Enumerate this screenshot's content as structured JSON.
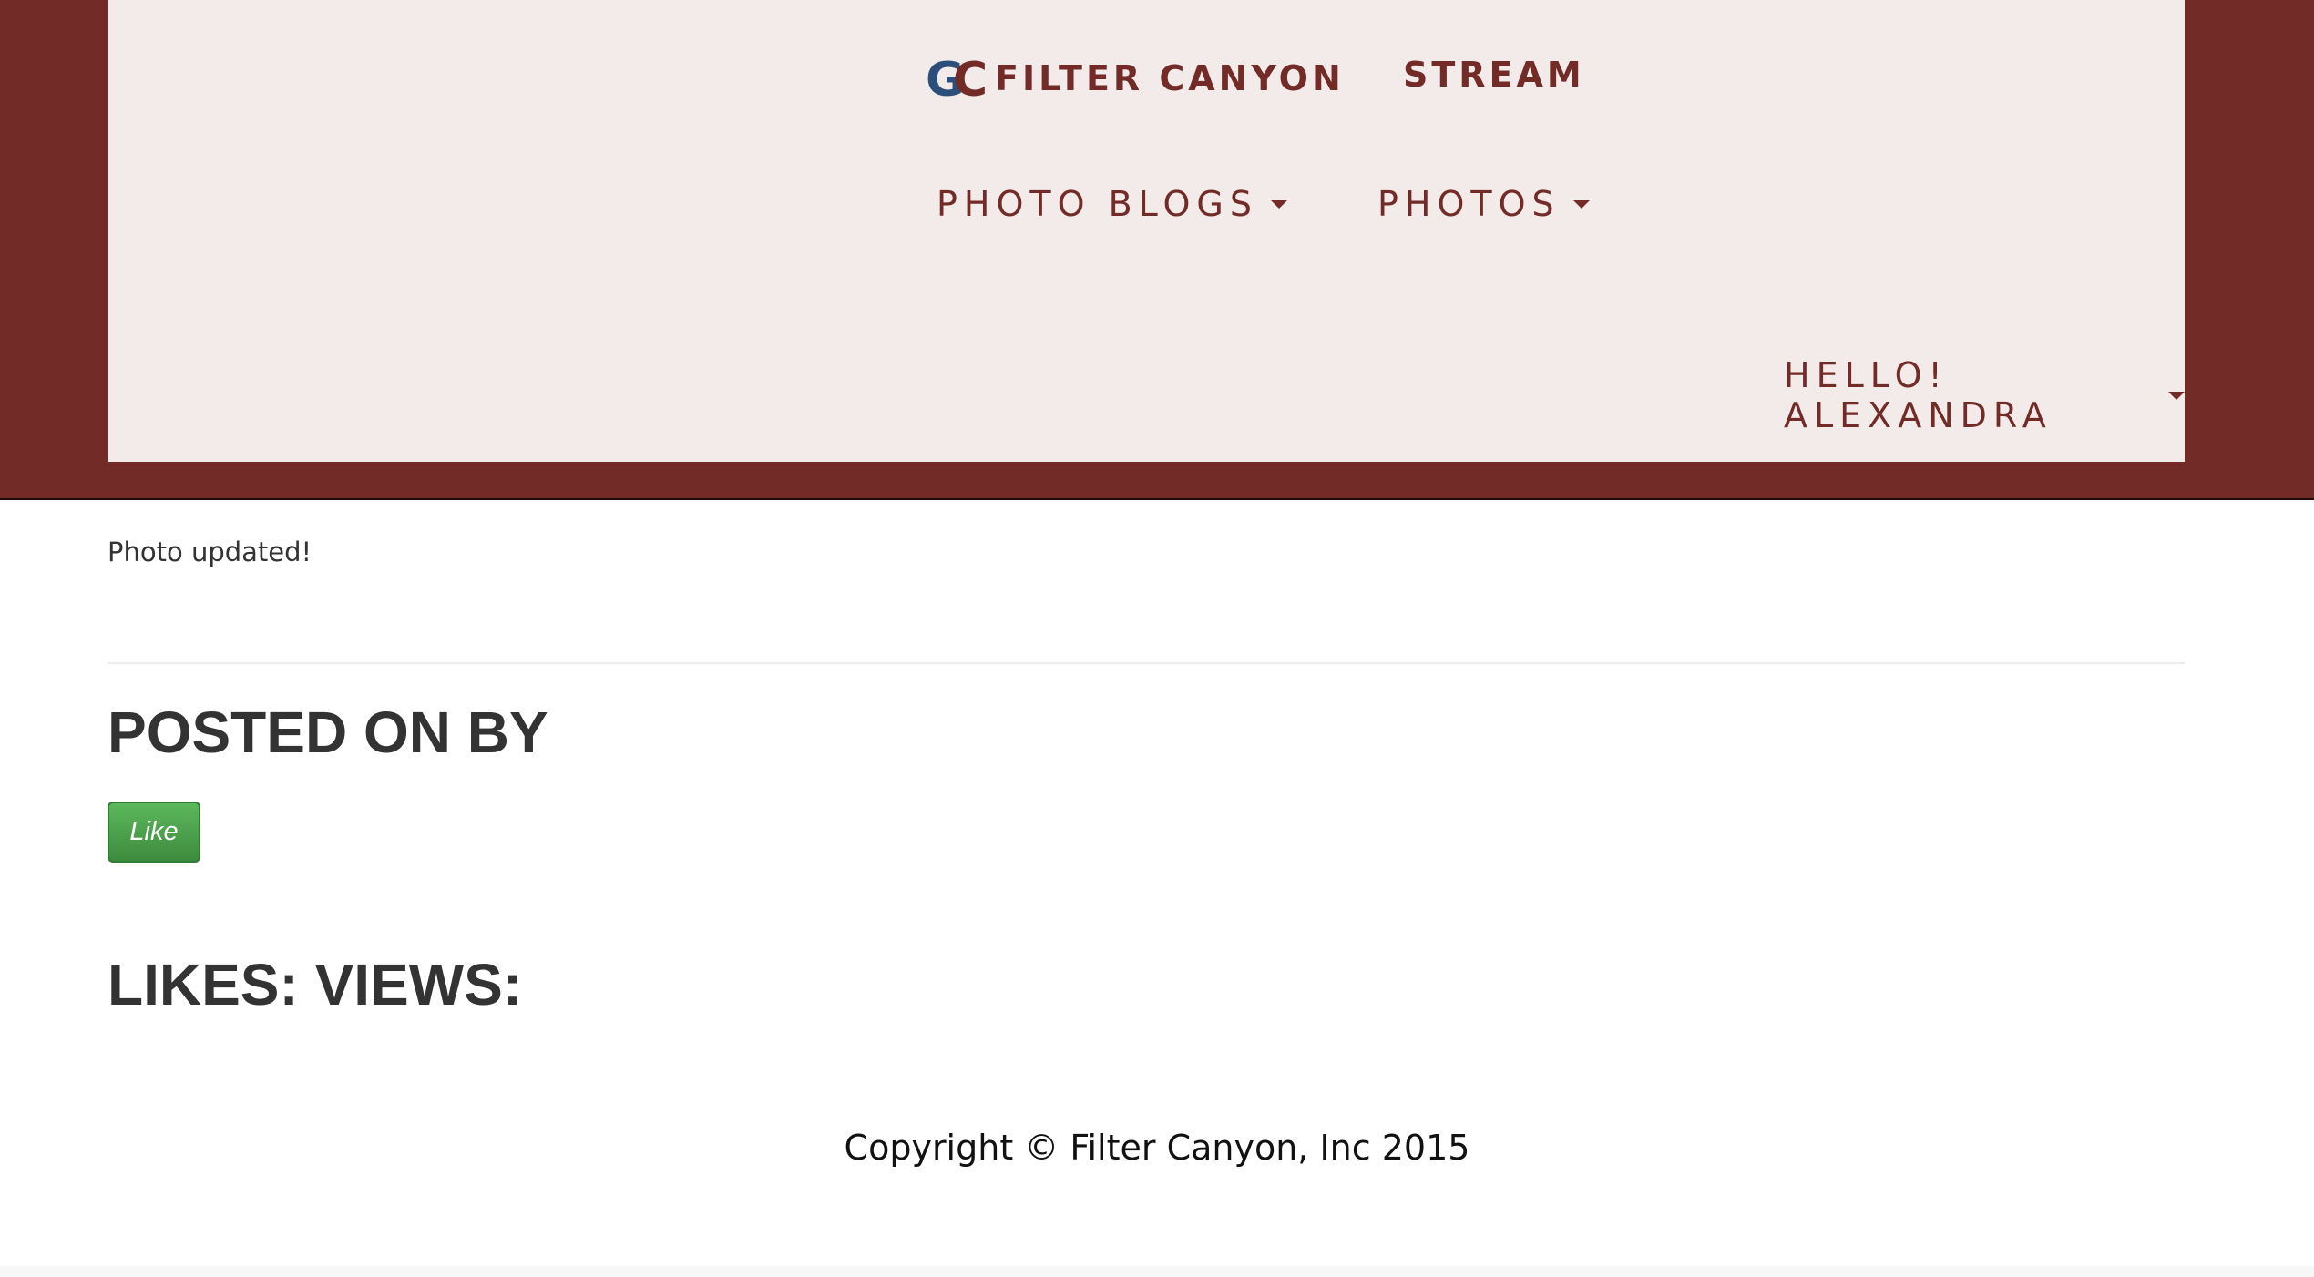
{
  "header": {
    "brand_name": "FILTER CANYON",
    "logo_letters": "GC",
    "stream_label": "STREAM",
    "nav": {
      "photo_blogs_label": "PHOTO BLOGS",
      "photos_label": "PHOTOS",
      "user_label": "HELLO! ALEXANDRA"
    }
  },
  "main": {
    "flash_message": "Photo updated!",
    "posted_heading": "POSTED ON BY",
    "like_button_label": "Like",
    "stats_heading": "LIKES: VIEWS:"
  },
  "footer": {
    "copyright": "Copyright © Filter Canyon, Inc 2015"
  },
  "colors": {
    "brand": "#722b26",
    "header_panel": "#f2ebea",
    "logo_blue": "#2b4f7a",
    "like_green": "#4cae4c",
    "heading_text": "#333333"
  }
}
